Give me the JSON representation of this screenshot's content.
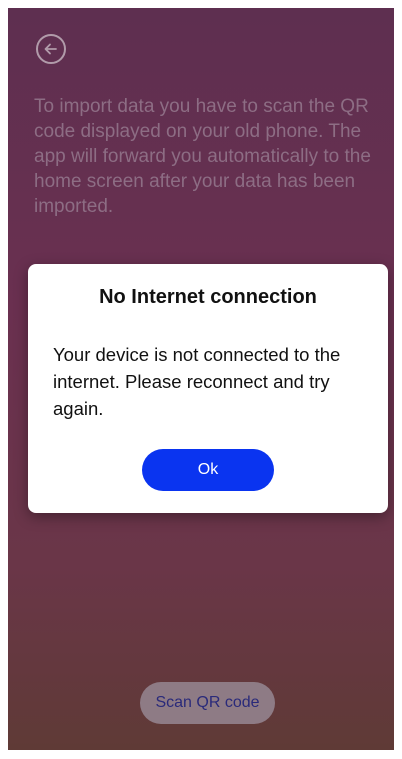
{
  "screen": {
    "back_icon": "arrow-left-circle-icon",
    "instructions": "To import data you have to scan the QR code displayed on your old phone. The app will forward you automatically to the home screen after your data has been imported.",
    "scan_button_label": "Scan QR code"
  },
  "dialog": {
    "title": "No Internet connection",
    "message": "Your device is not connected to the internet. Please reconnect and try again.",
    "ok_label": "Ok"
  },
  "colors": {
    "primary_button": "#0a34f0",
    "dialog_background": "#ffffff",
    "screen_gradient_top": "#5e2f50",
    "screen_gradient_bottom": "#5f3a36"
  }
}
